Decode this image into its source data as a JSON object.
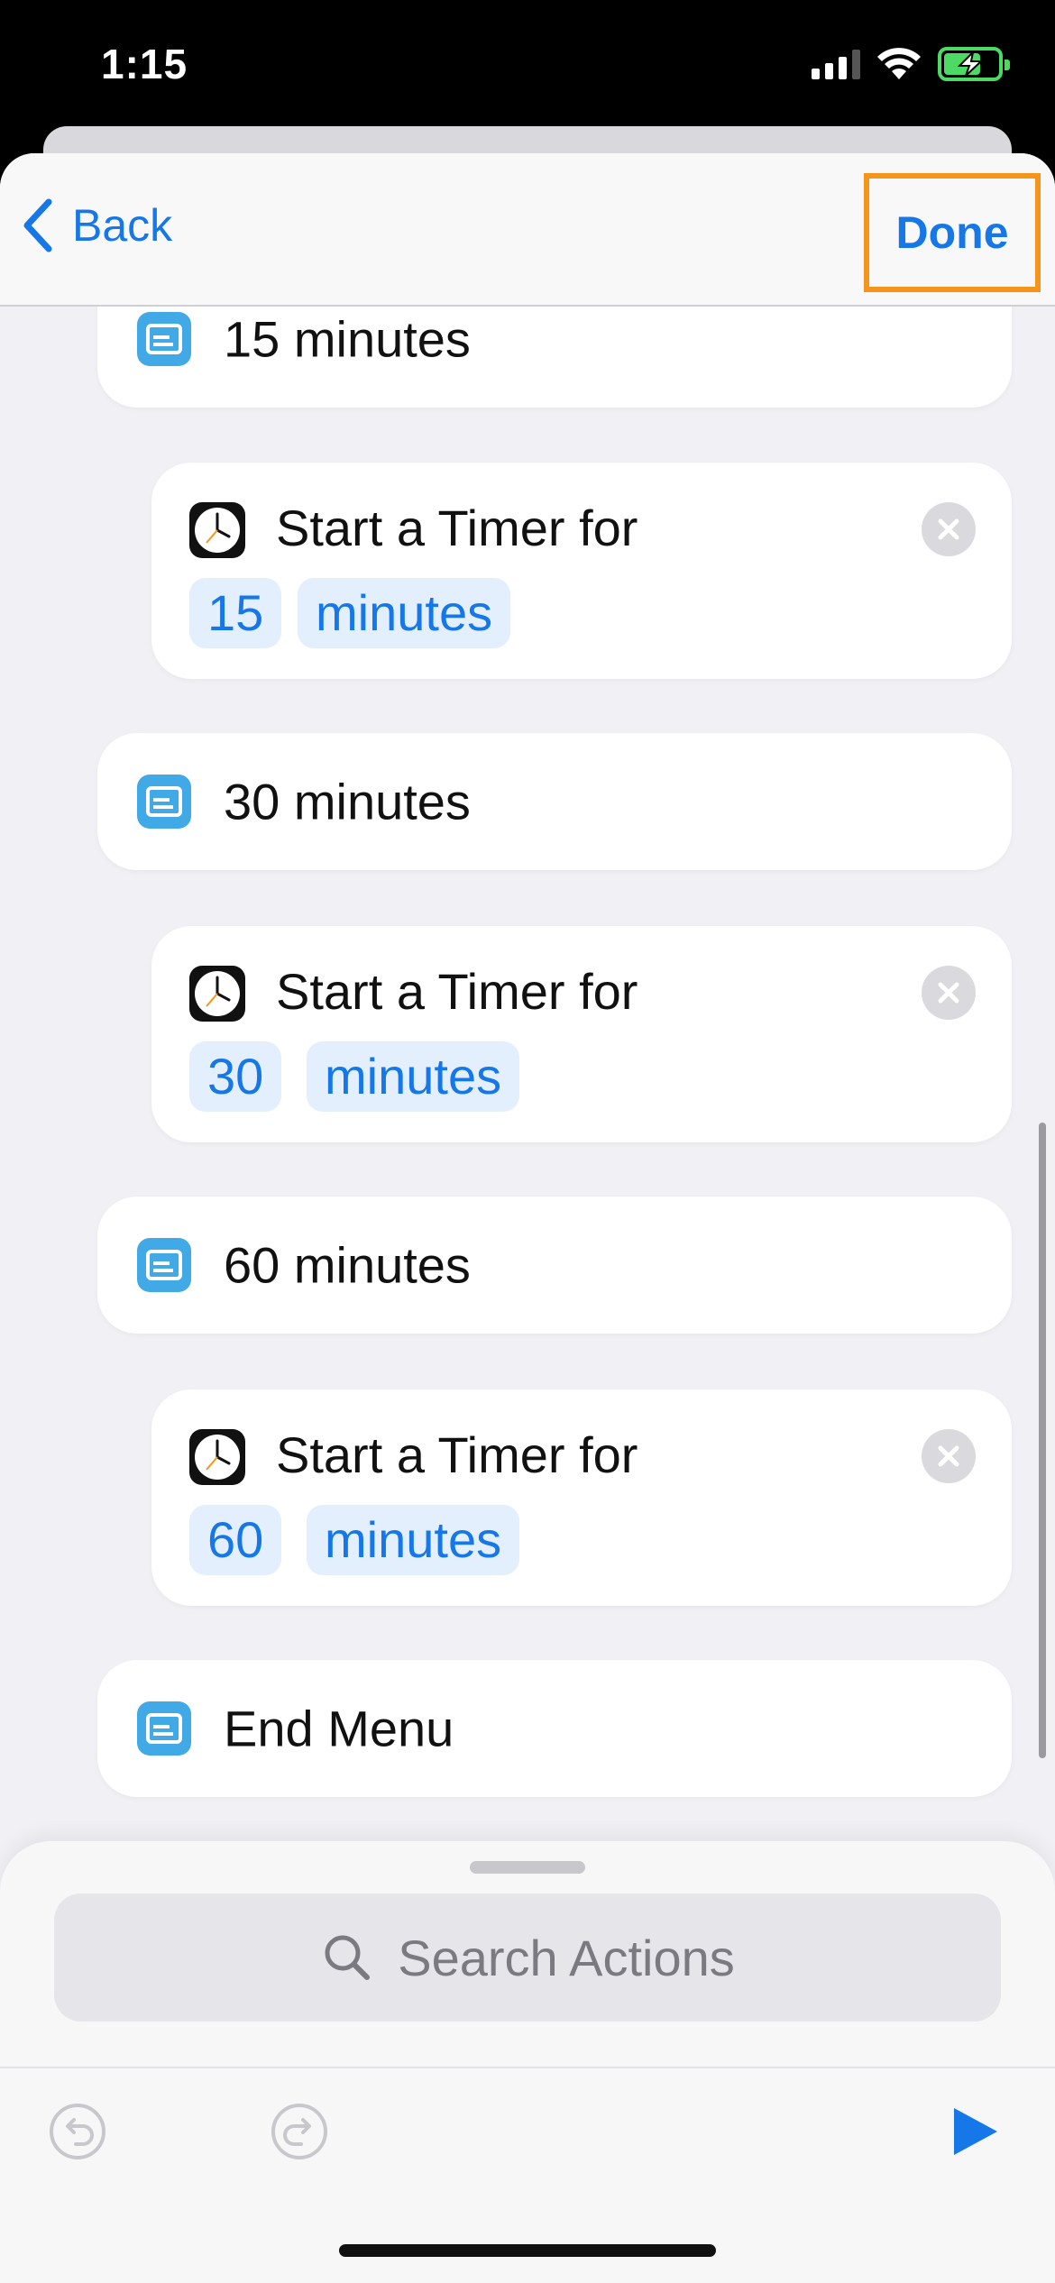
{
  "status_bar": {
    "time": "1:15"
  },
  "navbar": {
    "back_label": "Back",
    "done_label": "Done"
  },
  "actions": [
    {
      "type": "menu_item",
      "label": "15 minutes"
    },
    {
      "type": "timer",
      "title": "Start a Timer for",
      "amount": "15",
      "unit": "minutes"
    },
    {
      "type": "menu_item",
      "label": "30 minutes"
    },
    {
      "type": "timer",
      "title": "Start a Timer for",
      "amount": "30",
      "unit": "minutes"
    },
    {
      "type": "menu_item",
      "label": "60 minutes"
    },
    {
      "type": "timer",
      "title": "Start a Timer for",
      "amount": "60",
      "unit": "minutes"
    },
    {
      "type": "menu_item",
      "label": "End Menu"
    }
  ],
  "search": {
    "placeholder": "Search Actions"
  },
  "colors": {
    "accent": "#1677e8",
    "highlight": "#f3961b",
    "menu_icon": "#40a9e6",
    "battery": "#4cd964"
  },
  "icons": [
    "signal-icon",
    "wifi-icon",
    "battery-charging-icon",
    "back-chevron-icon",
    "menu-icon",
    "clock-icon",
    "remove-icon",
    "search-icon",
    "undo-icon",
    "redo-icon",
    "play-icon"
  ]
}
